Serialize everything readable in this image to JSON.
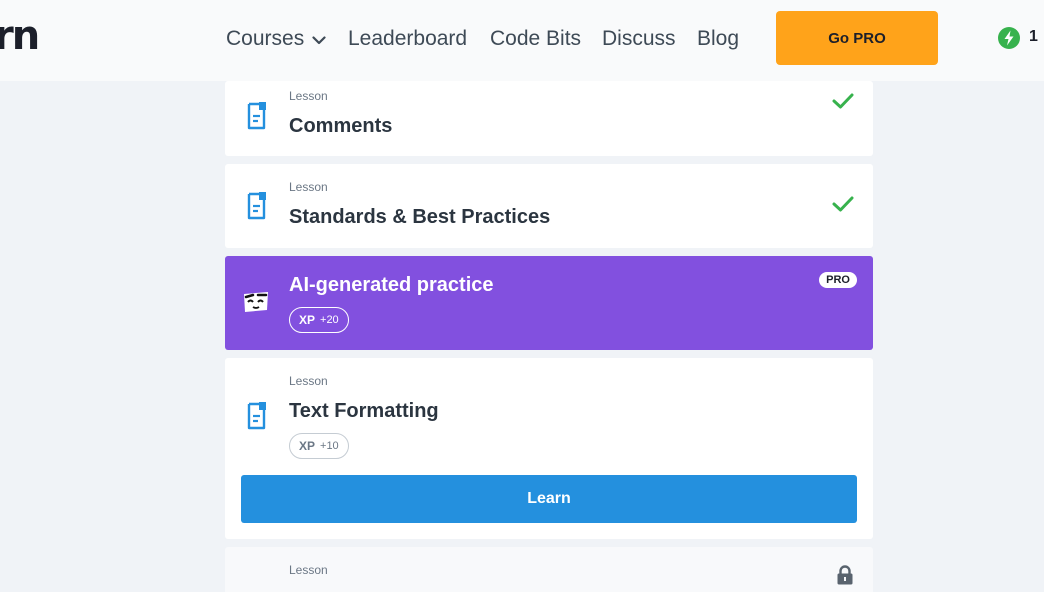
{
  "header": {
    "logo": "rn",
    "nav": [
      {
        "label": "Courses",
        "has_dropdown": true
      },
      {
        "label": "Leaderboard"
      },
      {
        "label": "Code Bits"
      },
      {
        "label": "Discuss"
      },
      {
        "label": "Blog"
      }
    ],
    "gopro_label": "Go PRO",
    "streak_count": "1"
  },
  "lessons": [
    {
      "kind": "Lesson",
      "title": "Comments",
      "status": "completed"
    },
    {
      "kind": "Lesson",
      "title": "Standards & Best Practices",
      "status": "completed"
    },
    {
      "title": "AI-generated practice",
      "badge": "PRO",
      "xp_label": "XP",
      "xp_value": "+20"
    },
    {
      "kind": "Lesson",
      "title": "Text Formatting",
      "xp_label": "XP",
      "xp_value": "+10",
      "button": "Learn"
    },
    {
      "kind": "Lesson",
      "status": "locked"
    }
  ],
  "colors": {
    "accent_orange": "#ffa31a",
    "ai_purple": "#8250df",
    "learn_blue": "#2490de",
    "check_green": "#37b24d",
    "icon_blue": "#2490de"
  },
  "icons": {
    "lesson": "document-icon",
    "done": "checkmark-icon",
    "locked": "lock-icon",
    "ai": "robot-face-icon",
    "streak": "lightning-bolt-icon",
    "dropdown": "chevron-down-icon"
  }
}
